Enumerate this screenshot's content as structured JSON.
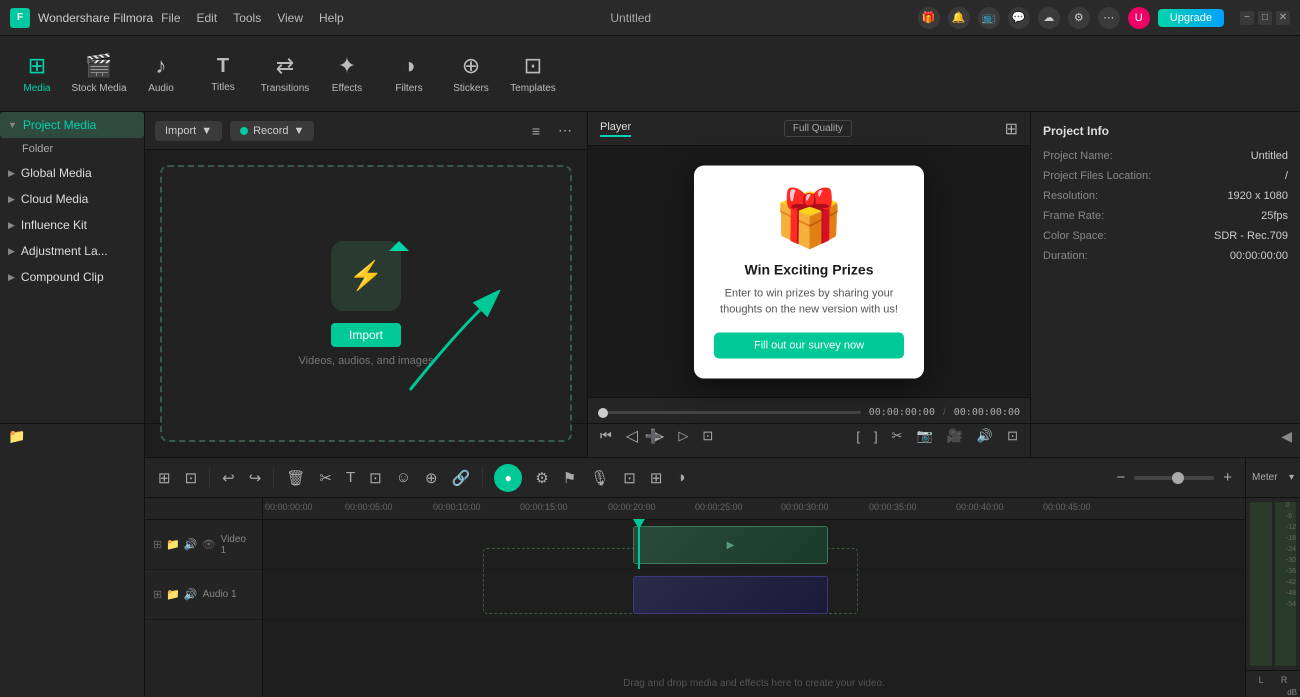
{
  "app": {
    "name": "Wondershare Filmora",
    "title": "Untitled"
  },
  "titlebar": {
    "menus": [
      "File",
      "Edit",
      "Tools",
      "View",
      "Help"
    ],
    "upgrade_label": "Upgrade",
    "window_controls": [
      "minimize",
      "maximize",
      "close"
    ]
  },
  "toolbar": {
    "items": [
      {
        "id": "media",
        "label": "Media",
        "icon": "⊞"
      },
      {
        "id": "stock",
        "label": "Stock Media",
        "icon": "🎬"
      },
      {
        "id": "audio",
        "label": "Audio",
        "icon": "♪"
      },
      {
        "id": "titles",
        "label": "Titles",
        "icon": "T"
      },
      {
        "id": "transitions",
        "label": "Transitions",
        "icon": "⇄"
      },
      {
        "id": "effects",
        "label": "Effects",
        "icon": "✦"
      },
      {
        "id": "filters",
        "label": "Filters",
        "icon": "◑"
      },
      {
        "id": "stickers",
        "label": "Stickers",
        "icon": "⊕"
      },
      {
        "id": "templates",
        "label": "Templates",
        "icon": "⊡"
      }
    ]
  },
  "left_panel": {
    "title": "Project Media",
    "items": [
      {
        "label": "Folder",
        "indent": true
      },
      {
        "label": "Global Media",
        "indent": false
      },
      {
        "label": "Cloud Media",
        "indent": false
      },
      {
        "label": "Influence Kit",
        "indent": false
      },
      {
        "label": "Adjustment La...",
        "indent": false
      },
      {
        "label": "Compound Clip",
        "indent": false
      }
    ]
  },
  "media_toolbar": {
    "import_label": "Import",
    "record_label": "Record"
  },
  "drop_zone": {
    "import_btn": "Import",
    "hint_text": "Videos, audios, and images"
  },
  "player": {
    "tabs": [
      "Player",
      "Full Quality"
    ],
    "current_time": "00:00:00:00",
    "total_time": "00:00:00:00"
  },
  "prize_popup": {
    "title": "Win Exciting Prizes",
    "text": "Enter to win prizes by sharing your thoughts on the new version with us!",
    "button": "Fill out our survey now"
  },
  "project_info": {
    "title": "Project Info",
    "name_label": "Project Name:",
    "name_value": "Untitled",
    "files_label": "Project Files Location:",
    "files_value": "/",
    "resolution_label": "Resolution:",
    "resolution_value": "1920 x 1080",
    "framerate_label": "Frame Rate:",
    "framerate_value": "25fps",
    "colorspace_label": "Color Space:",
    "colorspace_value": "SDR - Rec.709",
    "duration_label": "Duration:",
    "duration_value": "00:00:00:00"
  },
  "timeline": {
    "tracks": [
      {
        "label": "Video 1",
        "type": "video"
      },
      {
        "label": "Audio 1",
        "type": "audio"
      }
    ],
    "timecodes": [
      "00:00:00:00",
      "00:00:05:00",
      "00:00:10:00",
      "00:00:15:00",
      "00:00:20:00",
      "00:00:25:00",
      "00:00:30:00",
      "00:00:35:00",
      "00:00:40:00",
      "00:00:45:00"
    ],
    "drag_hint": "Drag and drop media and effects here to create your video."
  },
  "meter": {
    "title": "Meter",
    "db_labels": [
      "0",
      "-6",
      "-12",
      "-18",
      "-24",
      "-30",
      "-36",
      "-42",
      "-48",
      "-54"
    ],
    "channels": [
      "L",
      "R"
    ],
    "db_suffix": "dB"
  }
}
